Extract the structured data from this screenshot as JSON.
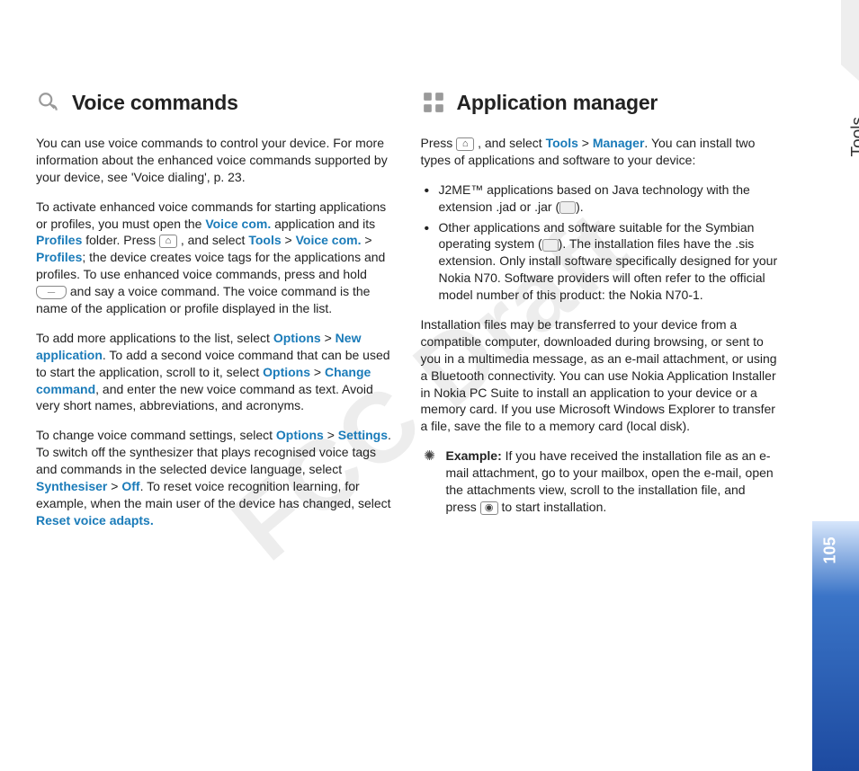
{
  "watermark": "FCC Draft",
  "side": {
    "section": "Tools",
    "page": "105"
  },
  "left": {
    "heading": "Voice commands",
    "p1a": "You can use voice commands to control your device. For more information about the enhanced voice commands supported by your device, see 'Voice dialing', p. 23.",
    "p2": {
      "a": "To activate enhanced voice commands for starting applications or profiles, you must open the ",
      "voice_com": "Voice com.",
      "b": " application and its ",
      "profiles": "Profiles",
      "c": " folder. Press ",
      "d": " , and select ",
      "tools": "Tools",
      "gt1": " > ",
      "voice_com2": "Voice com.",
      "gt2": " > ",
      "profiles2": "Profiles",
      "e": "; the device creates voice tags for the applications and profiles. To use enhanced voice commands, press and hold ",
      "f": " and say a voice command. The voice command is the name of the application or profile displayed in the list."
    },
    "p3": {
      "a": "To add more applications to the list, select ",
      "options": "Options",
      "gt1": " > ",
      "newapp": "New application",
      "b": ". To add a second voice command that can be used to start the application, scroll to it, select ",
      "options2": "Options",
      "gt2": " > ",
      "changecmd": "Change command",
      "c": ", and enter the new voice command as text. Avoid very short names, abbreviations, and acronyms."
    },
    "p4": {
      "a": "To change voice command settings, select ",
      "options": "Options",
      "gt1": " > ",
      "settings": "Settings",
      "b": ". To switch off the synthesizer that plays recognised voice tags and commands in the selected device language, select ",
      "synth": "Synthesiser",
      "gt2": " > ",
      "off": "Off",
      "c": ". To reset voice recognition learning, for example, when the main user of the device has changed, select ",
      "reset": "Reset voice adapts."
    }
  },
  "right": {
    "heading": "Application manager",
    "p1": {
      "a": "Press ",
      "b": " , and select ",
      "tools": "Tools",
      "gt": " > ",
      "manager": "Manager",
      "c": ". You can install two types of applications and software to your device:"
    },
    "li1": {
      "a": "J2ME™ applications based on Java technology with the extension .jad or .jar (",
      "b": ")."
    },
    "li2": {
      "a": "Other applications and software suitable for the Symbian operating system (",
      "b": "). The installation files have the .sis extension. Only install software specifically designed for your Nokia N70. Software providers will often refer to the official model number of this product: the Nokia N70-1."
    },
    "p2": "Installation files may be transferred to your device from a compatible computer, downloaded during browsing, or sent to you in a multimedia message, as an e-mail attachment, or using a Bluetooth connectivity. You can use Nokia Application Installer in Nokia PC Suite to install an application to your device or a memory card. If you use Microsoft Windows Explorer to transfer a file, save the file to a memory card (local disk).",
    "ex": {
      "label": "Example: ",
      "a": "If you have received the installation file as an e-mail attachment, go to your mailbox, open the e-mail, open the attachments view, scroll to the installation file, and press ",
      "b": " to start installation."
    }
  },
  "icons": {
    "voice": "voice-commands-icon",
    "apps": "application-manager-icon",
    "menu": "menu-key-icon",
    "softkey": "right-softkey-icon",
    "jar": "jar-file-icon",
    "sis": "sis-file-icon",
    "hint": "hint-icon",
    "joy": "joystick-press-icon"
  }
}
